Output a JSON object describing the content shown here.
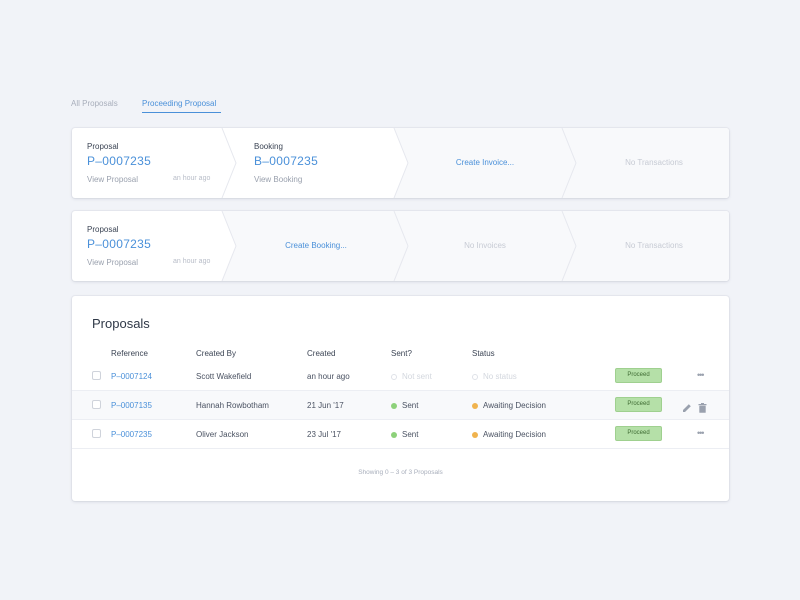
{
  "tabs": [
    {
      "label": "All Proposals",
      "active": false
    },
    {
      "label": "Proceeding Proposal",
      "active": true
    }
  ],
  "pipelines": [
    {
      "proposal": {
        "label": "Proposal",
        "code": "P–0007235",
        "link": "View Proposal",
        "time": "an hour ago"
      },
      "booking": {
        "label": "Booking",
        "code": "B–0007235",
        "link": "View Booking"
      },
      "invoice": "Create Invoice...",
      "transactions": "No Transactions"
    },
    {
      "proposal": {
        "label": "Proposal",
        "code": "P–0007235",
        "link": "View Proposal",
        "time": "an hour ago"
      },
      "booking": "Create Booking...",
      "invoice": "No Invoices",
      "transactions": "No Transactions"
    }
  ],
  "proposals": {
    "title": "Proposals",
    "columns": {
      "reference": "Reference",
      "created_by": "Created By",
      "created": "Created",
      "sent": "Sent?",
      "status": "Status"
    },
    "rows": [
      {
        "reference": "P–0007124",
        "created_by": "Scott Wakefield",
        "created": "an hour ago",
        "sent": "Not sent",
        "status": "No status",
        "action": "Proceed",
        "menu_icon": "more-icon"
      },
      {
        "reference": "P–0007135",
        "created_by": "Hannah Rowbotham",
        "created": "21 Jun '17",
        "sent": "Sent",
        "status": "Awaiting Decision",
        "action": "Proceed",
        "menu_icon": "edit-and-trash-icons"
      },
      {
        "reference": "P–0007235",
        "created_by": "Oliver Jackson",
        "created": "23 Jul '17",
        "sent": "Sent",
        "status": "Awaiting Decision",
        "action": "Proceed",
        "menu_icon": "more-icon"
      }
    ],
    "footer": "Showing 0 – 3 of 3 Proposals"
  },
  "colors": {
    "accent": "#4a90d9",
    "sent": "#8dd17a",
    "awaiting": "#f0b34e",
    "proceed_bg": "#b5e0a8",
    "background": "#f1f3f8"
  }
}
